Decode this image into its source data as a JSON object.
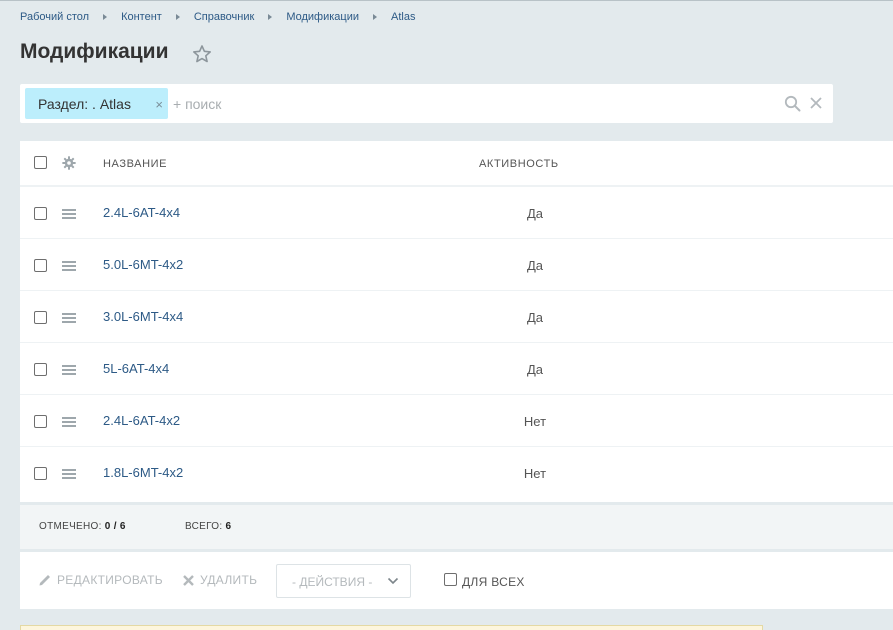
{
  "breadcrumb": [
    "Рабочий стол",
    "Контент",
    "Справочник",
    "Модификации",
    "Atlas"
  ],
  "title": "Модификации",
  "filter": {
    "chip_label": "Раздел: . Atlas",
    "chip_close": "×",
    "search_placeholder": "+ поиск"
  },
  "columns": {
    "name": "НАЗВАНИЕ",
    "active": "АКТИВНОСТЬ"
  },
  "rows": [
    {
      "name": "2.4L-6AT-4x4",
      "active": "Да"
    },
    {
      "name": "5.0L-6MT-4x2",
      "active": "Да"
    },
    {
      "name": "3.0L-6MT-4x4",
      "active": "Да"
    },
    {
      "name": "5L-6AT-4x4",
      "active": "Да"
    },
    {
      "name": "2.4L-6AT-4x2",
      "active": "Нет"
    },
    {
      "name": "1.8L-6MT-4x2",
      "active": "Нет"
    }
  ],
  "counters": {
    "selected_label": "ОТМЕЧЕНО:",
    "selected_value": "0 / 6",
    "total_label": "ВСЕГО:",
    "total_value": "6"
  },
  "actions": {
    "edit": "РЕДАКТИРОВАТЬ",
    "delete": "УДАЛИТЬ",
    "select": "- ДЕЙСТВИЯ -",
    "for_all": "ДЛЯ ВСЕХ"
  },
  "icons": {
    "star": "star-icon",
    "search": "search-icon",
    "clear": "close-icon",
    "gear": "gear-icon",
    "drag": "drag-handle-icon",
    "pencil": "pencil-icon",
    "cross": "delete-icon",
    "chevron": "chevron-down-icon"
  },
  "colors": {
    "background": "#e3eaed",
    "link": "#2d5a86",
    "chip": "#bceefc"
  }
}
